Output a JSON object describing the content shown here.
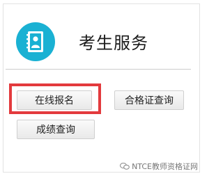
{
  "header": {
    "title": "考生服务"
  },
  "buttons": {
    "register": "在线报名",
    "certificate": "合格证查询",
    "scores": "成绩查询"
  },
  "watermark": {
    "text": "NTCE教师资格证网"
  },
  "colors": {
    "accent": "#1ab1d3",
    "highlight": "#e33a3d"
  },
  "icons": {
    "logo": "address-book-icon",
    "watermark": "wechat-icon"
  }
}
